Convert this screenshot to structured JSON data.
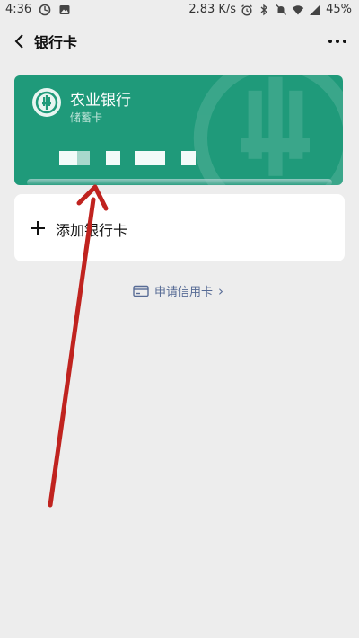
{
  "status_bar": {
    "time": "4:36",
    "network_speed": "2.83 K/s",
    "battery": "45%"
  },
  "nav": {
    "title": "银行卡"
  },
  "card": {
    "bank_name": "农业银行",
    "card_type": "储蓄卡",
    "color": "#1f9a7a"
  },
  "add_card": {
    "label": "添加银行卡"
  },
  "apply_credit": {
    "label": "申请信用卡",
    "chevron": "›"
  },
  "annotation": {
    "arrow_color": "#c0231f"
  }
}
